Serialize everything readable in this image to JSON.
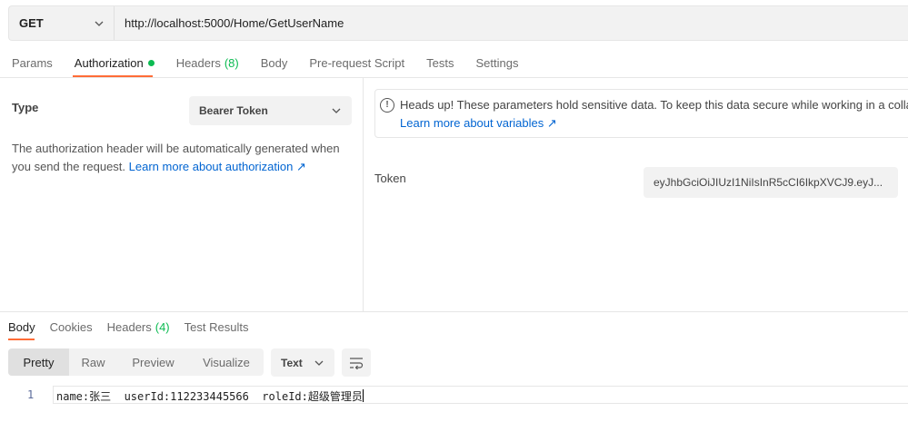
{
  "request": {
    "method": "GET",
    "url": "http://localhost:5000/Home/GetUserName"
  },
  "request_tabs": [
    {
      "label": "Params"
    },
    {
      "label": "Authorization"
    },
    {
      "label": "Headers",
      "count": "(8)"
    },
    {
      "label": "Body"
    },
    {
      "label": "Pre-request Script"
    },
    {
      "label": "Tests"
    },
    {
      "label": "Settings"
    }
  ],
  "auth": {
    "type_label": "Type",
    "type_value": "Bearer Token",
    "description": "The authorization header will be automatically generated when you send the request.",
    "description_link": "Learn more about authorization ↗",
    "alert_text": "Heads up! These parameters hold sensitive data. To keep this data secure while working in a collab",
    "alert_link": "Learn more about variables ↗",
    "token_label": "Token",
    "token_value": "eyJhbGciOiJIUzI1NiIsInR5cCI6IkpXVCJ9.eyJ..."
  },
  "response_tabs": [
    {
      "label": "Body"
    },
    {
      "label": "Cookies"
    },
    {
      "label": "Headers",
      "count": "(4)"
    },
    {
      "label": "Test Results"
    }
  ],
  "response_view": {
    "modes": [
      "Pretty",
      "Raw",
      "Preview",
      "Visualize"
    ],
    "format": "Text"
  },
  "response_body": {
    "line_number": "1",
    "text": "name:张三  userId:112233445566  roleId:超级管理员"
  },
  "colors": {
    "accent": "#ff6c37",
    "success": "#0cbb52",
    "link": "#0265d2"
  }
}
